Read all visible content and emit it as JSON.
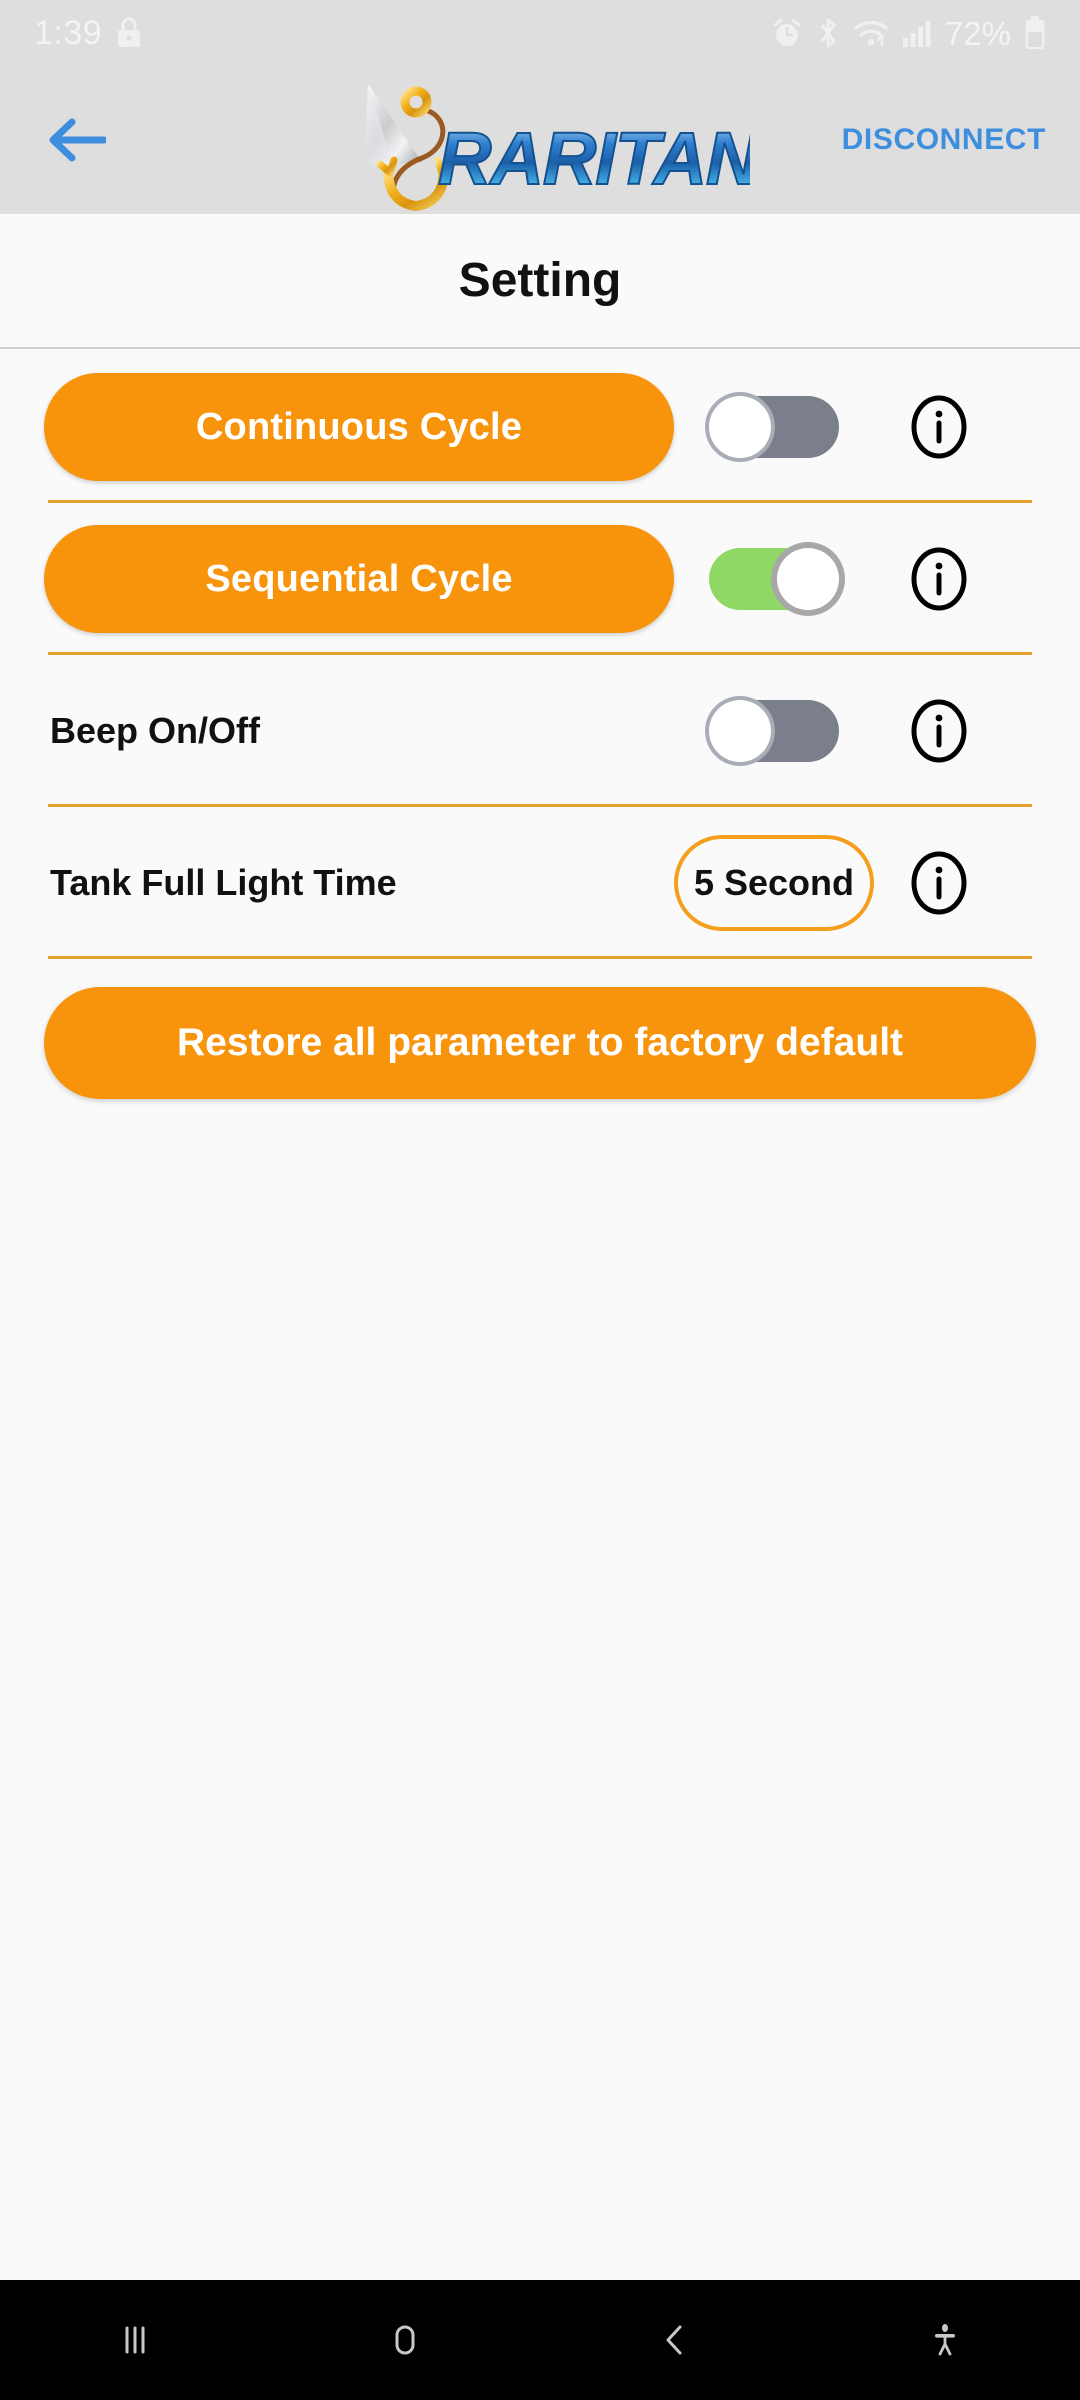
{
  "status_bar": {
    "time": "1:39",
    "battery_percent": "72%",
    "icons": [
      "lock-icon",
      "alarm-icon",
      "bluetooth-icon",
      "wifi-icon",
      "signal-icon",
      "battery-icon"
    ]
  },
  "app_bar": {
    "back_label": "back-arrow",
    "logo_text": "RARITAN",
    "disconnect_label": "DISCONNECT",
    "accent_blue": "#3e8ede"
  },
  "page": {
    "title": "Setting"
  },
  "settings": {
    "rows": [
      {
        "label": "Continuous Cycle",
        "style": "pill",
        "control": "toggle",
        "toggle_state": "off",
        "info": "i"
      },
      {
        "label": "Sequential Cycle",
        "style": "pill",
        "control": "toggle",
        "toggle_state": "on",
        "info": "i"
      },
      {
        "label": "Beep On/Off",
        "style": "plain",
        "control": "toggle",
        "toggle_state": "off",
        "info": "i"
      },
      {
        "label": "Tank Full Light Time",
        "style": "plain",
        "control": "value",
        "value": "5 Second",
        "info": "i"
      }
    ],
    "restore_label": "Restore all parameter to factory default",
    "accent_orange": "#f8930c",
    "toggle_on_color": "#8fd866",
    "toggle_off_color": "#7b7f8c",
    "divider_color": "#e39f2a"
  },
  "nav_bar": {
    "items": [
      "recents-icon",
      "home-icon",
      "back-icon",
      "accessibility-icon"
    ]
  }
}
